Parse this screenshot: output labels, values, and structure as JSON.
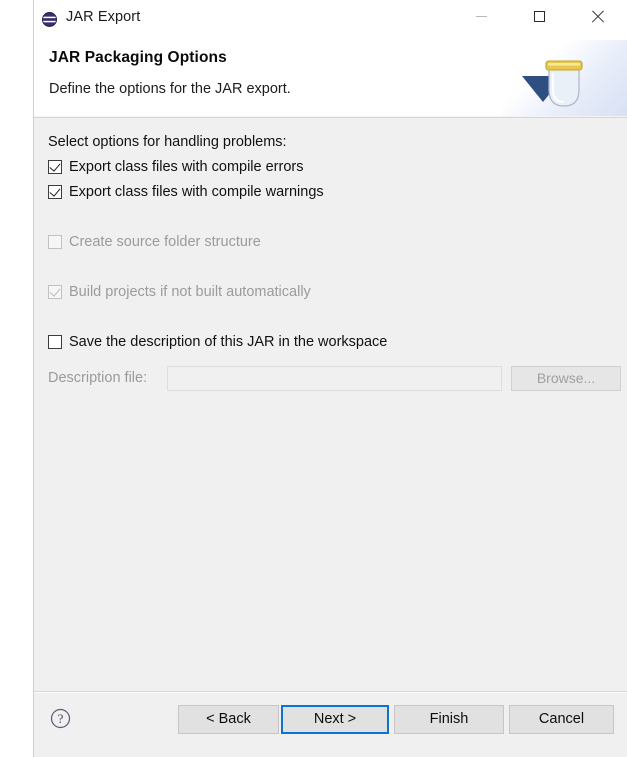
{
  "window": {
    "title": "JAR Export",
    "icon": "jar-export-icon",
    "controls": {
      "minimize": "minimize-icon",
      "maximize": "maximize-icon",
      "close": "close-icon"
    }
  },
  "header": {
    "title": "JAR Packaging Options",
    "subtitle": "Define the options for the JAR export.",
    "banner_icon": "jar-with-export-arrow-graphic"
  },
  "main": {
    "section_label": "Select options for handling problems:",
    "options": [
      {
        "label": "Export class files with compile errors",
        "checked": true,
        "enabled": true
      },
      {
        "label": "Export class files with compile warnings",
        "checked": true,
        "enabled": true
      },
      {
        "label": "Create source folder structure",
        "checked": false,
        "enabled": false
      },
      {
        "label": "Build projects if not built automatically",
        "checked": true,
        "enabled": false
      },
      {
        "label": "Save the description of this JAR in the workspace",
        "checked": false,
        "enabled": true
      }
    ],
    "description_file": {
      "label": "Description file:",
      "value": "",
      "placeholder": "",
      "browse_label": "Browse...",
      "enabled": false
    }
  },
  "footer": {
    "help_icon": "help-question-icon",
    "buttons": {
      "back": "< Back",
      "next": "Next >",
      "finish": "Finish",
      "cancel": "Cancel"
    },
    "default_button": "Next >"
  },
  "colors": {
    "panel_background": "#f0f0f0",
    "accent_focus": "#0a73d4",
    "title_text": "#1b1b1b",
    "disabled_text": "#9b9b9b",
    "jar_lid": "#e8c84a"
  }
}
